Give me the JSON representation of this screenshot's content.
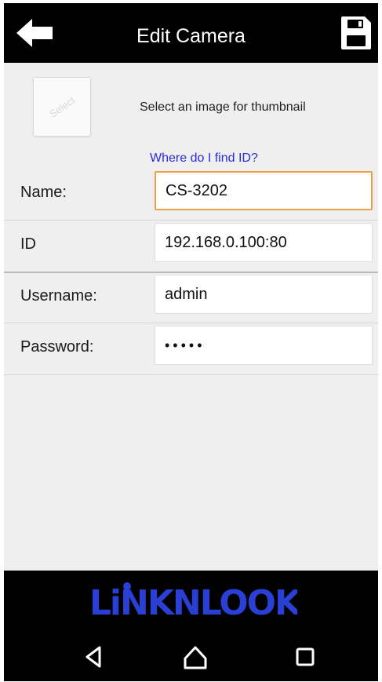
{
  "header": {
    "title": "Edit Camera",
    "back_icon": "back-arrow-icon",
    "save_icon": "floppy-save-icon"
  },
  "thumbnail": {
    "button_label": "Select",
    "caption": "Select an image for thumbnail"
  },
  "help_link": "Where do I find ID?",
  "form": {
    "name": {
      "label": "Name:",
      "value": "CS-3202"
    },
    "id": {
      "label": "ID",
      "value": "192.168.0.100:80"
    },
    "username": {
      "label": "Username:",
      "value": "admin"
    },
    "password": {
      "label": "Password:",
      "value": "•••••"
    }
  },
  "footer": {
    "logo_text": "LiNKNLOOK",
    "logo_color": "#2a3fd4"
  },
  "colors": {
    "app_bar": "#000000",
    "background": "#efefef",
    "focus_border": "#f0a04b",
    "link": "#2b2bdf"
  },
  "nav_icons": [
    "back-triangle-icon",
    "home-icon",
    "recents-square-icon"
  ]
}
